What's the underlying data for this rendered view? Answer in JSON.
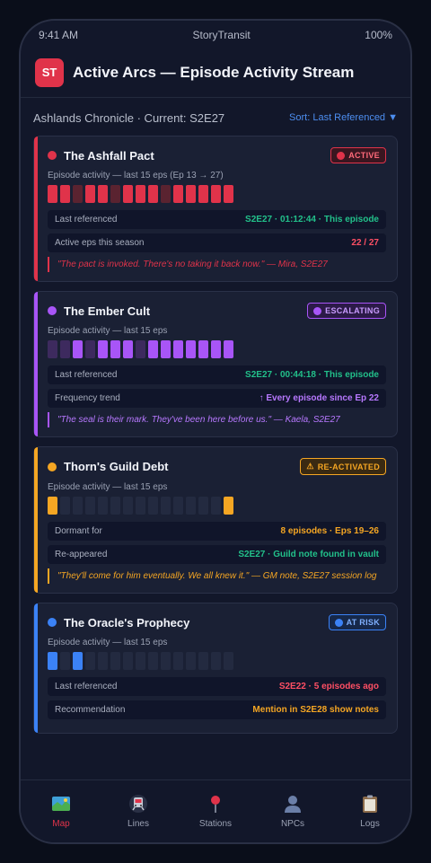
{
  "status": {
    "time": "9:41 AM",
    "carrier": "StoryTransit",
    "battery": "100%"
  },
  "header": {
    "logo": "ST",
    "title": "Active Arcs — Episode Activity Stream"
  },
  "subbar": {
    "chronicle": "Ashlands Chronicle · Current: S2E27",
    "sort": "Sort: Last Referenced ▼"
  },
  "colors": {
    "red": "#e0334a",
    "purple": "#a855f7",
    "amber": "#f5a623",
    "blue": "#3b82f6",
    "green": "#22c08a"
  },
  "cards": [
    {
      "name": "The Ashfall Pact",
      "badge": "ACTIVE",
      "activity_label": "Episode activity — last 15 eps (Ep 13 → 27)",
      "activity": [
        1,
        1,
        0,
        1,
        1,
        0,
        1,
        1,
        1,
        0,
        1,
        1,
        1,
        1,
        1
      ],
      "rows": [
        {
          "k": "Last referenced",
          "v": "S2E27 · 01:12:44 · This episode"
        },
        {
          "k": "Active eps this season",
          "v": "22 / 27"
        }
      ],
      "quote": "\"The pact is invoked. There's no taking it back now.\" — Mira, S2E27"
    },
    {
      "name": "The Ember Cult",
      "badge": "ESCALATING",
      "activity_label": "Episode activity — last 15 eps",
      "activity": [
        0,
        0,
        1,
        0,
        1,
        1,
        1,
        0,
        1,
        1,
        1,
        1,
        1,
        1,
        1
      ],
      "rows": [
        {
          "k": "Last referenced",
          "v": "S2E27 · 00:44:18 · This episode"
        },
        {
          "k": "Frequency trend",
          "v": "↑ Every episode since Ep 22"
        }
      ],
      "quote": "\"The seal is their mark. They've been here before us.\" — Kaela, S2E27"
    },
    {
      "name": "Thorn's Guild Debt",
      "badge": "RE-ACTIVATED",
      "activity_label": "Episode activity — last 15 eps",
      "activity": [
        1,
        0,
        0,
        0,
        0,
        0,
        0,
        0,
        0,
        0,
        0,
        0,
        0,
        0,
        1
      ],
      "rows": [
        {
          "k": "Dormant for",
          "v": "8 episodes · Eps 19–26"
        },
        {
          "k": "Re-appeared",
          "v": "S2E27 · Guild note found in vault"
        }
      ],
      "quote": "\"They'll come for him eventually. We all knew it.\" — GM note, S2E27 session log"
    },
    {
      "name": "The Oracle's Prophecy",
      "badge": "AT RISK",
      "activity_label": "Episode activity — last 15 eps",
      "activity": [
        1,
        0,
        1,
        0,
        0,
        0,
        0,
        0,
        0,
        0,
        0,
        0,
        0,
        0,
        0
      ],
      "rows": [
        {
          "k": "Last referenced",
          "v": "S2E22 · 5 episodes ago"
        },
        {
          "k": "Recommendation",
          "v": "Mention in S2E28 show notes"
        }
      ],
      "quote": ""
    }
  ],
  "tabs": [
    {
      "label": "Map",
      "icon": "map-icon",
      "active": true
    },
    {
      "label": "Lines",
      "icon": "train-icon",
      "active": false
    },
    {
      "label": "Stations",
      "icon": "pin-icon",
      "active": false
    },
    {
      "label": "NPCs",
      "icon": "person-icon",
      "active": false
    },
    {
      "label": "Logs",
      "icon": "clipboard-icon",
      "active": false
    }
  ]
}
